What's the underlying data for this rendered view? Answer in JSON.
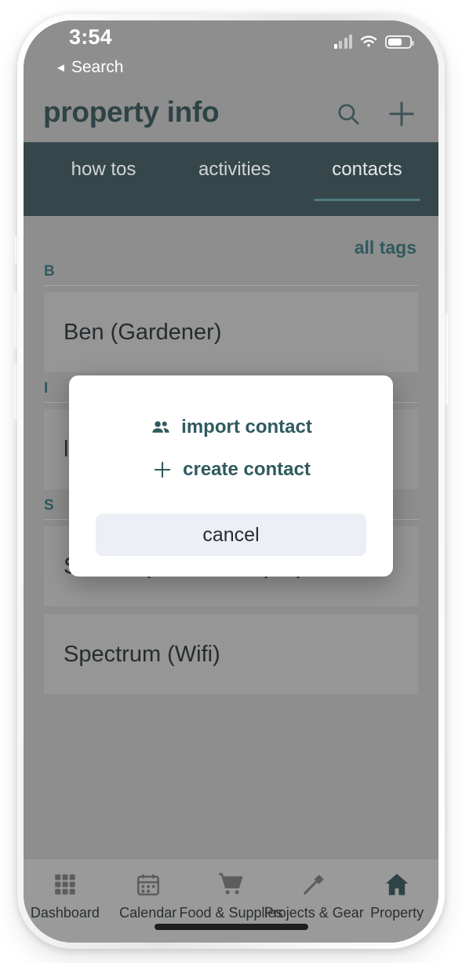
{
  "status_bar": {
    "time": "3:54",
    "back_label": "Search",
    "back_icon": "triangle-left-icon",
    "signal_icon": "cellular-signal-icon",
    "wifi_icon": "wifi-icon",
    "battery_icon": "battery-icon"
  },
  "app_bar": {
    "title": "property info",
    "search_icon": "search-icon",
    "add_icon": "plus-icon"
  },
  "tabs": [
    {
      "label": "how tos",
      "active": false
    },
    {
      "label": "activities",
      "active": false
    },
    {
      "label": "contacts",
      "active": true
    }
  ],
  "content": {
    "all_tags_label": "all tags",
    "sections": [
      {
        "letter": "B",
        "items": [
          {
            "name": "Ben (Gardener)"
          }
        ]
      },
      {
        "letter": "I",
        "items": [
          {
            "name": "la"
          }
        ]
      },
      {
        "letter": "S",
        "items": [
          {
            "name": "Sharon (House Keeper)"
          },
          {
            "name": "Spectrum (Wifi)"
          }
        ]
      }
    ]
  },
  "modal": {
    "import_label": "import contact",
    "import_icon": "people-icon",
    "create_label": "create contact",
    "create_icon": "plus-icon",
    "cancel_label": "cancel"
  },
  "bottom_nav": [
    {
      "label": "Dashboard",
      "icon": "grid-icon",
      "active": false
    },
    {
      "label": "Calendar",
      "icon": "calendar-icon",
      "active": false
    },
    {
      "label": "Food & Supplies",
      "icon": "cart-icon",
      "active": false
    },
    {
      "label": "Projects & Gear",
      "icon": "hammer-icon",
      "active": false
    },
    {
      "label": "Property",
      "icon": "home-icon",
      "active": true
    }
  ],
  "colors": {
    "accent_teal": "#2f5a5f",
    "tab_bar_dark": "#36474c",
    "screen_dim_gray": "#8e8e8e",
    "modal_bg": "#ffffff",
    "cancel_bg": "#eceff5"
  }
}
